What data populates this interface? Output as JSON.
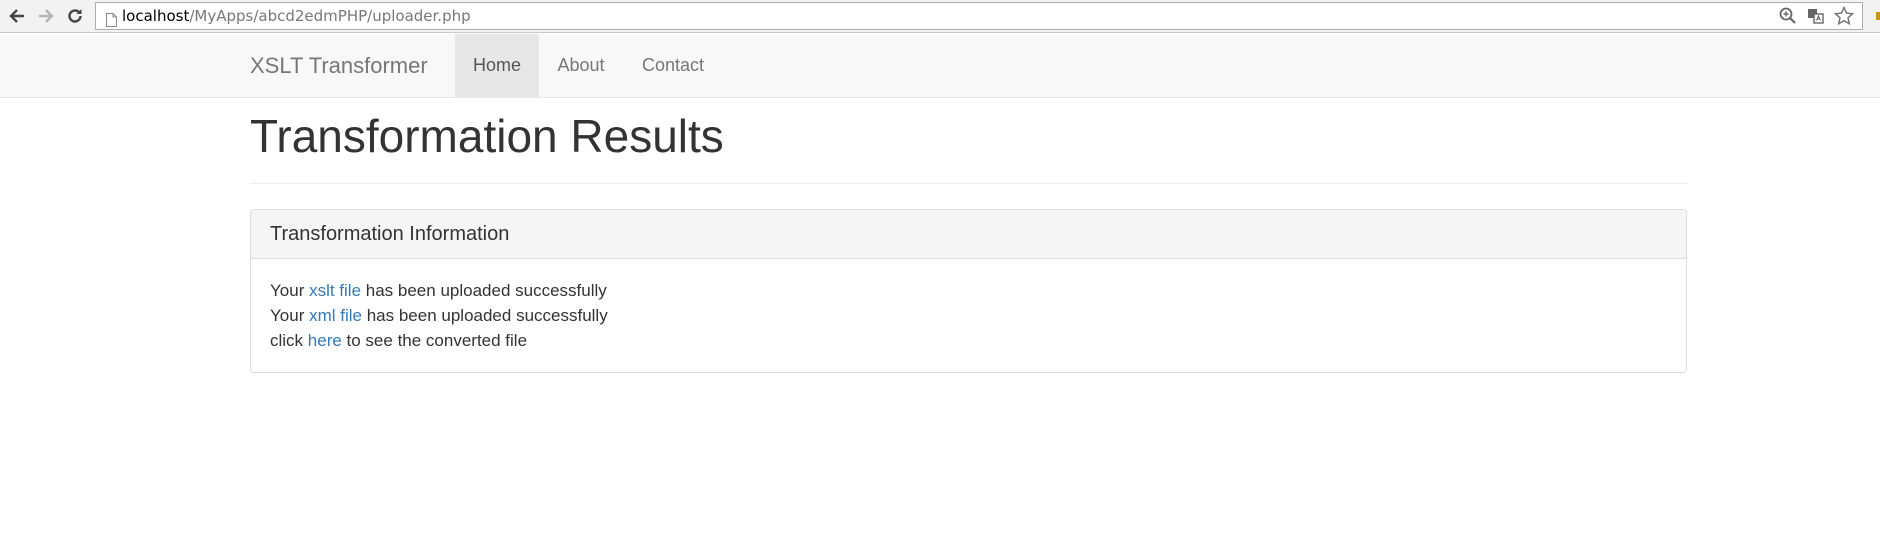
{
  "browser": {
    "url_host": "localhost",
    "url_path": "/MyApps/abcd2edmPHP/uploader.php",
    "icons": [
      "back-arrow-icon",
      "forward-arrow-icon",
      "reload-icon",
      "page-icon",
      "zoom-icon",
      "translate-icon",
      "star-icon"
    ]
  },
  "navbar": {
    "brand": "XSLT Transformer",
    "items": [
      {
        "label": "Home",
        "active": true
      },
      {
        "label": "About",
        "active": false
      },
      {
        "label": "Contact",
        "active": false
      }
    ]
  },
  "main": {
    "title": "Transformation Results",
    "panel": {
      "heading": "Transformation Information",
      "lines": [
        {
          "prefix": "Your ",
          "link": "xslt file",
          "suffix": " has been uploaded successfully"
        },
        {
          "prefix": "Your ",
          "link": "xml file",
          "suffix": " has been uploaded successfully"
        },
        {
          "prefix": "click ",
          "link": "here",
          "suffix": " to see the converted file"
        }
      ]
    }
  },
  "colors": {
    "link": "#337ab7",
    "navbar_bg": "#f8f8f8",
    "active_nav_bg": "#e7e7e7",
    "text": "#333333"
  }
}
